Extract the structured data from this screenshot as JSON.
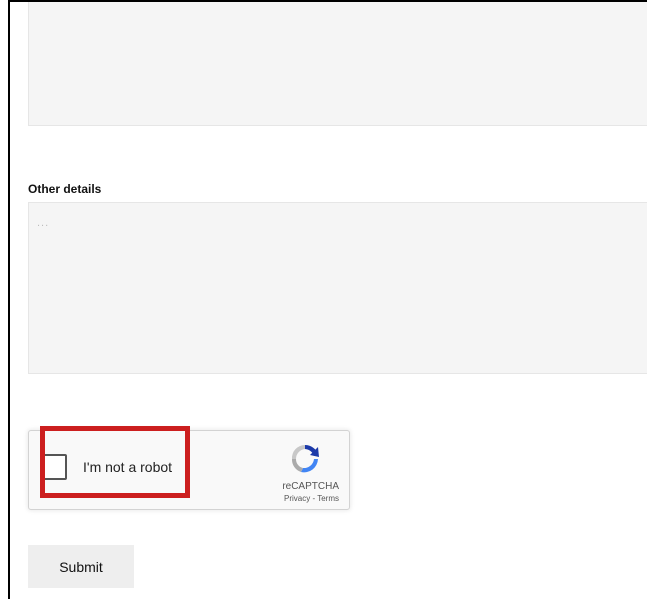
{
  "form": {
    "other_details_label": "Other details",
    "other_details_placeholder": "...",
    "submit_label": "Submit"
  },
  "recaptcha": {
    "checkbox_label": "I'm not a robot",
    "brand": "reCAPTCHA",
    "privacy": "Privacy",
    "separator": "-",
    "terms": "Terms",
    "logo_icon": "recaptcha-logo-icon",
    "checked": false
  },
  "colors": {
    "highlight": "#cc1f1f",
    "field_bg": "#f5f5f5",
    "submit_bg": "#eeeeee"
  }
}
